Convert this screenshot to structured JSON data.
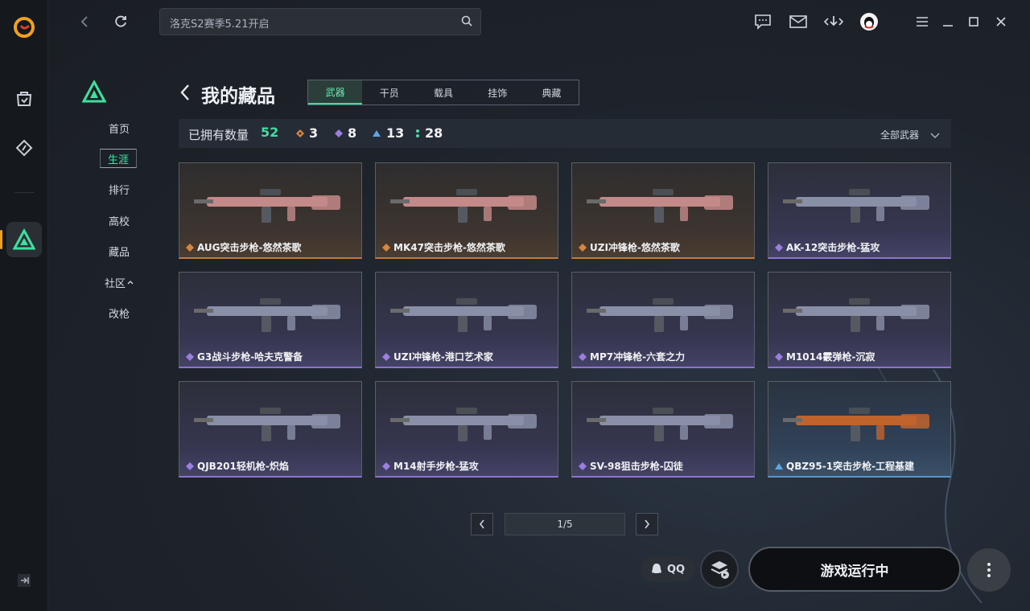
{
  "search": {
    "placeholder": "洛克S2赛季5.21开启"
  },
  "page": {
    "title": "我的藏品"
  },
  "subnav": [
    {
      "label": "首页"
    },
    {
      "label": "生涯"
    },
    {
      "label": "排行"
    },
    {
      "label": "高校"
    },
    {
      "label": "藏品"
    },
    {
      "label": "社区"
    },
    {
      "label": "改枪"
    }
  ],
  "subnav_active_index": 1,
  "tabs": [
    {
      "label": "武器"
    },
    {
      "label": "干员"
    },
    {
      "label": "载具"
    },
    {
      "label": "挂饰"
    },
    {
      "label": "典藏"
    }
  ],
  "tabs_active_index": 0,
  "counts": {
    "label": "已拥有数量",
    "total": "52",
    "orange": "3",
    "purple": "8",
    "blue": "13",
    "green": "28"
  },
  "filter": {
    "label": "全部武器"
  },
  "weapons": [
    {
      "name": "AUG突击步枪-悠然茶歌",
      "rarity": "orange"
    },
    {
      "name": "MK47突击步枪-悠然茶歌",
      "rarity": "orange"
    },
    {
      "name": "UZI冲锋枪-悠然茶歌",
      "rarity": "orange"
    },
    {
      "name": "AK-12突击步枪-猛攻",
      "rarity": "purple"
    },
    {
      "name": "G3战斗步枪-哈夫克警备",
      "rarity": "purple"
    },
    {
      "name": "UZI冲锋枪-港口艺术家",
      "rarity": "purple"
    },
    {
      "name": "MP7冲锋枪-六套之力",
      "rarity": "purple"
    },
    {
      "name": "M1014霰弹枪-沉寂",
      "rarity": "purple"
    },
    {
      "name": "QJB201轻机枪-炽焰",
      "rarity": "purple"
    },
    {
      "name": "M14射手步枪-猛攻",
      "rarity": "purple"
    },
    {
      "name": "SV-98狙击步枪-囚徒",
      "rarity": "purple"
    },
    {
      "name": "QBZ95-1突击步枪-工程基建",
      "rarity": "blue"
    }
  ],
  "pager": {
    "label": "1/5"
  },
  "bottom": {
    "qq_label": "QQ",
    "launch_label": "游戏运行中"
  },
  "colors": {
    "accent": "#3ee0a0",
    "orange": "#d9843f",
    "purple": "#9b7ee0",
    "blue": "#5fa6e0",
    "green": "#3ee0a0"
  }
}
